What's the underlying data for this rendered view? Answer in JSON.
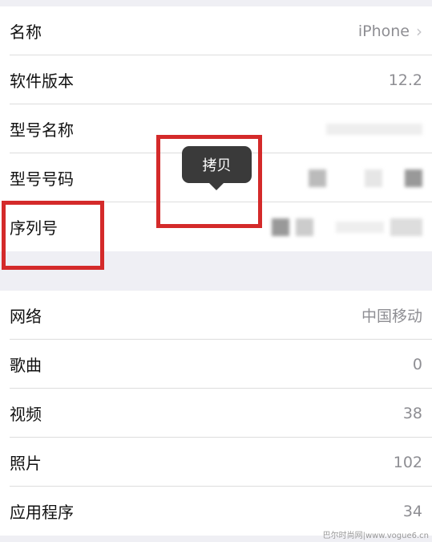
{
  "group1": [
    {
      "label": "名称",
      "value": "iPhone",
      "chevron": true
    },
    {
      "label": "软件版本",
      "value": "12.2"
    },
    {
      "label": "型号名称",
      "value": "",
      "blurred": true
    },
    {
      "label": "型号号码",
      "value": "",
      "blurred": true
    },
    {
      "label": "序列号",
      "value": "",
      "blurred": true
    }
  ],
  "group2": [
    {
      "label": "网络",
      "value": "中国移动"
    },
    {
      "label": "歌曲",
      "value": "0"
    },
    {
      "label": "视频",
      "value": "38"
    },
    {
      "label": "照片",
      "value": "102"
    },
    {
      "label": "应用程序",
      "value": "34"
    }
  ],
  "tooltip": {
    "label": "拷贝"
  },
  "annotation_color": "#d42a2a",
  "watermark": "巴尔时尚网|www.vogue6.cn"
}
